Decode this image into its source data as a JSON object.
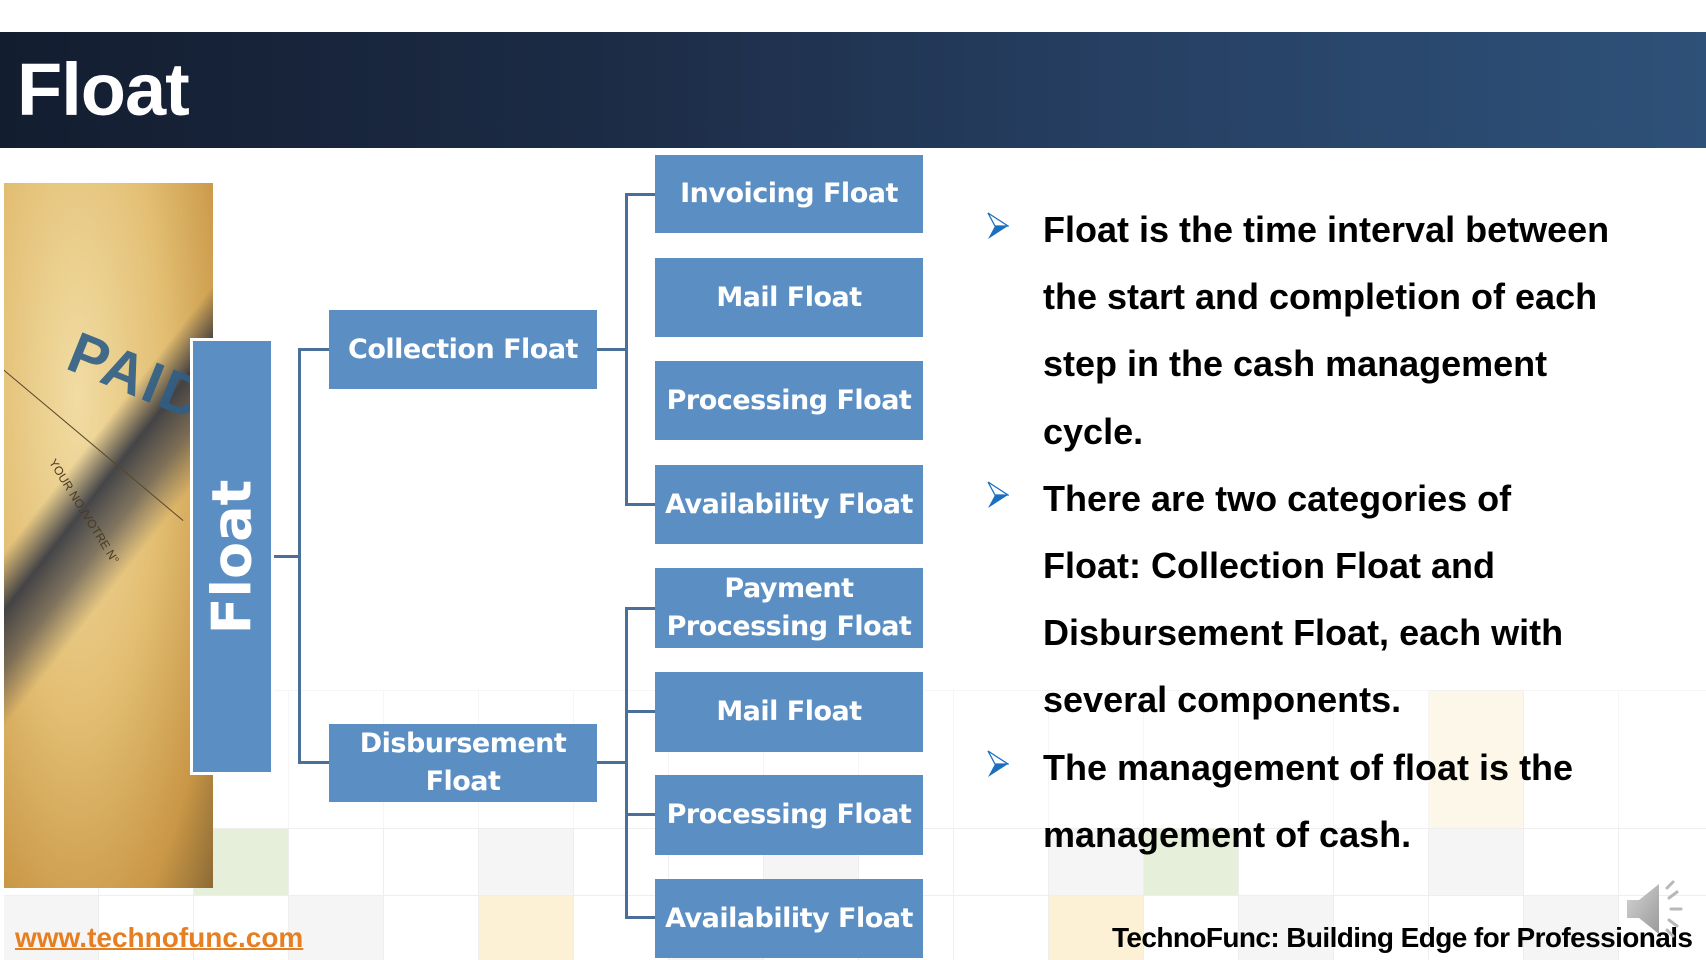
{
  "header": {
    "title": "Float"
  },
  "photo": {
    "stamp_text": "PAID",
    "form_text": "YOUR NO./VOTRE N°"
  },
  "diagram": {
    "root": "Float",
    "branches": [
      {
        "label": "Collection Float",
        "children": [
          "Invoicing Float",
          "Mail Float",
          "Processing Float",
          "Availability Float"
        ]
      },
      {
        "label_line1": "Disbursement",
        "label_line2": "Float",
        "children_special": {
          "line1": "Payment",
          "line2": "Processing Float"
        },
        "children": [
          "Mail Float",
          "Processing Float",
          "Availability Float"
        ]
      }
    ]
  },
  "bullets": {
    "icon": "arrowhead-bullet-icon",
    "items": [
      {
        "lines": [
          "Float is the time interval between",
          "the start and completion of each",
          "step in the cash management",
          "cycle."
        ]
      },
      {
        "lines": [
          "There are two categories of",
          "Float: Collection Float and",
          "Disbursement Float, each with",
          "several components."
        ]
      },
      {
        "lines": [
          "The management of float is the",
          "management of cash."
        ]
      }
    ]
  },
  "footer": {
    "url": "www.technofunc.com",
    "tagline": "TechnoFunc: Building Edge for Professionals",
    "audio_icon": "speaker-icon"
  },
  "colors": {
    "header_left": "#131d30",
    "header_right": "#2e5179",
    "node_fill": "#5b8fc4",
    "connector": "#4a6f98",
    "bullet_blue": "#1a6fbf",
    "url_orange": "#e67e22"
  }
}
